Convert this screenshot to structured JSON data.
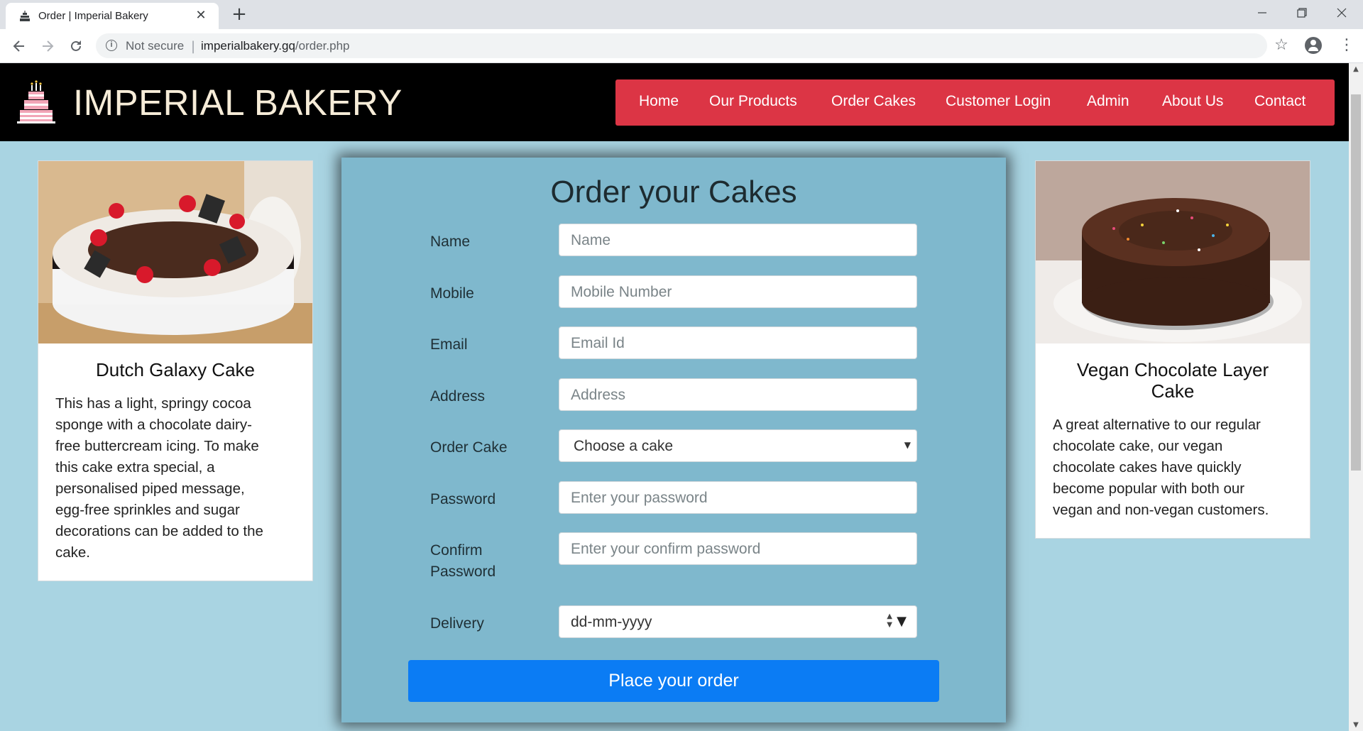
{
  "browser": {
    "tab_title": "Order | Imperial Bakery",
    "new_tab": "+",
    "close": "✕",
    "security_label": "Not secure",
    "url_host": "imperialbakery.gq",
    "url_path": "/order.php"
  },
  "site": {
    "brand": "IMPERIAL BAKERY",
    "nav": [
      "Home",
      "Our Products",
      "Order Cakes",
      "Customer Login",
      "Admin",
      "About Us",
      "Contact"
    ]
  },
  "cards": {
    "left": {
      "title": "Dutch Galaxy Cake",
      "lines": [
        "This has a light, springy cocoa",
        "sponge with a chocolate dairy-",
        "free buttercream icing. To make",
        "this cake extra special, a",
        "personalised piped message,",
        "egg-free sprinkles and sugar",
        "decorations can be added to the",
        "cake."
      ]
    },
    "right": {
      "title_lines": [
        "Vegan Chocolate Layer",
        "Cake"
      ],
      "lines": [
        "A great alternative to our regular",
        "chocolate cake, our vegan",
        "chocolate cakes have quickly",
        "become popular with both our",
        "vegan and non-vegan customers."
      ]
    }
  },
  "form": {
    "title": "Order your Cakes",
    "fields": {
      "name": {
        "label": "Name",
        "placeholder": "Name"
      },
      "mobile": {
        "label": "Mobile",
        "placeholder": "Mobile Number"
      },
      "email": {
        "label": "Email",
        "placeholder": "Email Id"
      },
      "address": {
        "label": "Address",
        "placeholder": "Address"
      },
      "cake": {
        "label": "Order Cake",
        "value": "Choose a cake"
      },
      "password": {
        "label": "Password",
        "placeholder": "Enter your password"
      },
      "confirm": {
        "label_lines": [
          "Confirm",
          "Password"
        ],
        "placeholder": "Enter your confirm password"
      },
      "delivery": {
        "label": "Delivery",
        "placeholder": "dd-mm-yyyy"
      }
    },
    "submit": "Place your order"
  },
  "colors": {
    "nav_bg": "#dc3545",
    "page_bg": "#a9d4e2",
    "form_bg": "#7fb8cd",
    "submit_bg": "#0b7cf4",
    "header_bg": "#000000"
  },
  "icons": [
    "cake-favicon",
    "back-arrow-icon",
    "forward-arrow-icon",
    "reload-icon",
    "info-icon",
    "star-icon",
    "account-icon",
    "kebab-menu-icon",
    "bakery-logo-icon"
  ]
}
